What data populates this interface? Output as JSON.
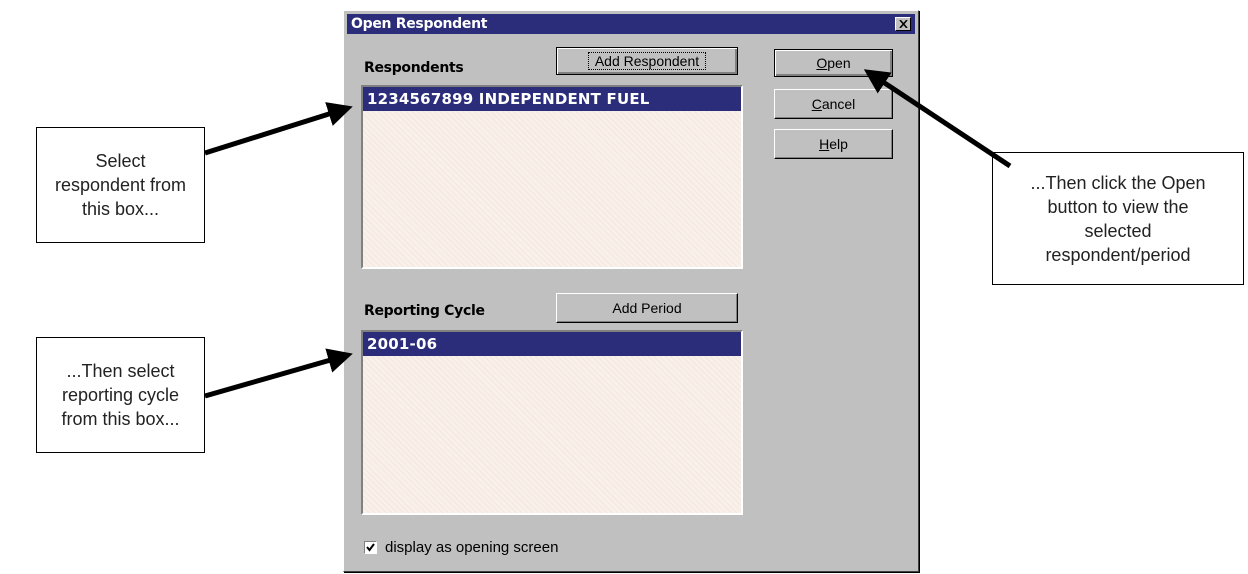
{
  "dialog": {
    "title": "Open Respondent",
    "close_glyph": "✕",
    "respondents": {
      "label": "Respondents",
      "add_button": "Add Respondent",
      "items": [
        "1234567899 INDEPENDENT FUEL"
      ]
    },
    "reporting_cycle": {
      "label": "Reporting Cycle",
      "add_button": "Add Period",
      "items": [
        "2001-06"
      ]
    },
    "buttons": {
      "open": {
        "mnemonic": "O",
        "rest": "pen"
      },
      "cancel": {
        "mnemonic": "C",
        "rest": "ancel"
      },
      "help": {
        "mnemonic": "H",
        "rest": "elp"
      }
    },
    "checkbox": {
      "label": "display as opening screen",
      "checked": true
    }
  },
  "callouts": {
    "select_respondent": [
      "Select",
      "respondent from",
      "this box..."
    ],
    "select_cycle": [
      "...Then select",
      "reporting cycle",
      "from this box..."
    ],
    "open_button": [
      "...Then click the Open",
      "button to view the",
      "selected",
      "respondent/period"
    ]
  }
}
